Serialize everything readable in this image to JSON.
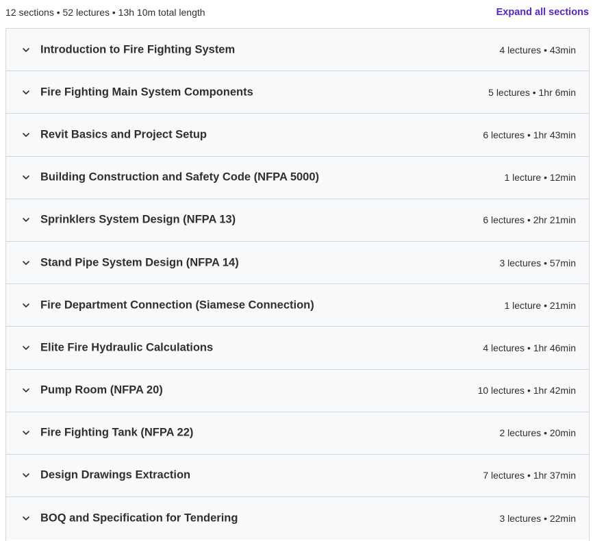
{
  "summary": {
    "text": "12 sections • 52 lectures • 13h 10m total length",
    "expand_label": "Expand all sections"
  },
  "colors": {
    "accent": "#5624d0",
    "section_bg": "#f7f9fa",
    "border": "#d1d7dc",
    "text": "#2d2f31"
  },
  "icons": {
    "section_toggle": "chevron-down-icon"
  },
  "sections": [
    {
      "title": "Introduction to Fire Fighting System",
      "meta": "4 lectures • 43min"
    },
    {
      "title": "Fire Fighting Main System Components",
      "meta": "5 lectures • 1hr 6min"
    },
    {
      "title": "Revit Basics and Project Setup",
      "meta": "6 lectures • 1hr 43min"
    },
    {
      "title": "Building Construction and Safety Code (NFPA 5000)",
      "meta": "1 lecture • 12min"
    },
    {
      "title": "Sprinklers System Design (NFPA 13)",
      "meta": "6 lectures • 2hr 21min"
    },
    {
      "title": "Stand Pipe System Design (NFPA 14)",
      "meta": "3 lectures • 57min"
    },
    {
      "title": "Fire Department Connection (Siamese Connection)",
      "meta": "1 lecture • 21min"
    },
    {
      "title": "Elite Fire Hydraulic Calculations",
      "meta": "4 lectures • 1hr 46min"
    },
    {
      "title": "Pump Room (NFPA 20)",
      "meta": "10 lectures • 1hr 42min"
    },
    {
      "title": "Fire Fighting Tank (NFPA 22)",
      "meta": "2 lectures • 20min"
    },
    {
      "title": "Design Drawings Extraction",
      "meta": "7 lectures • 1hr 37min"
    },
    {
      "title": "BOQ and Specification for Tendering",
      "meta": "3 lectures • 22min"
    }
  ]
}
